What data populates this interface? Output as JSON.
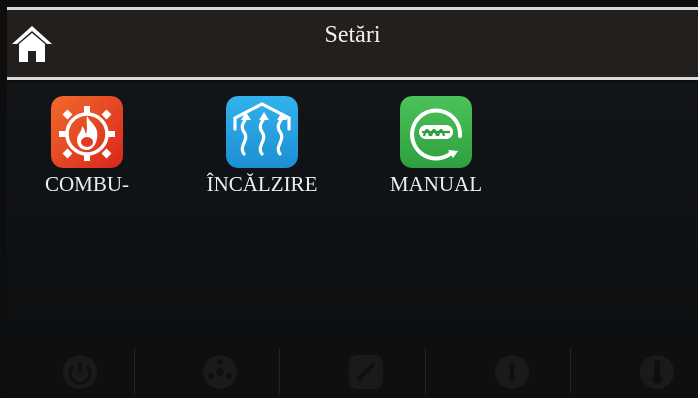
{
  "header": {
    "title": "Setări",
    "home_icon": "home-icon"
  },
  "tiles": [
    {
      "label": "COMBU-",
      "icon": "flame-gear-icon",
      "color": "#e8542a"
    },
    {
      "label": "ÎNCĂLZIRE",
      "icon": "heat-waves-icon",
      "color": "#2aa3e0"
    },
    {
      "label": "MANUAL",
      "icon": "auger-icon",
      "color": "#3bb34a"
    }
  ],
  "bottom_bar": {
    "icons": [
      "power-icon",
      "fan-icon",
      "edit-icon",
      "info-icon",
      "thermometer-icon"
    ]
  }
}
